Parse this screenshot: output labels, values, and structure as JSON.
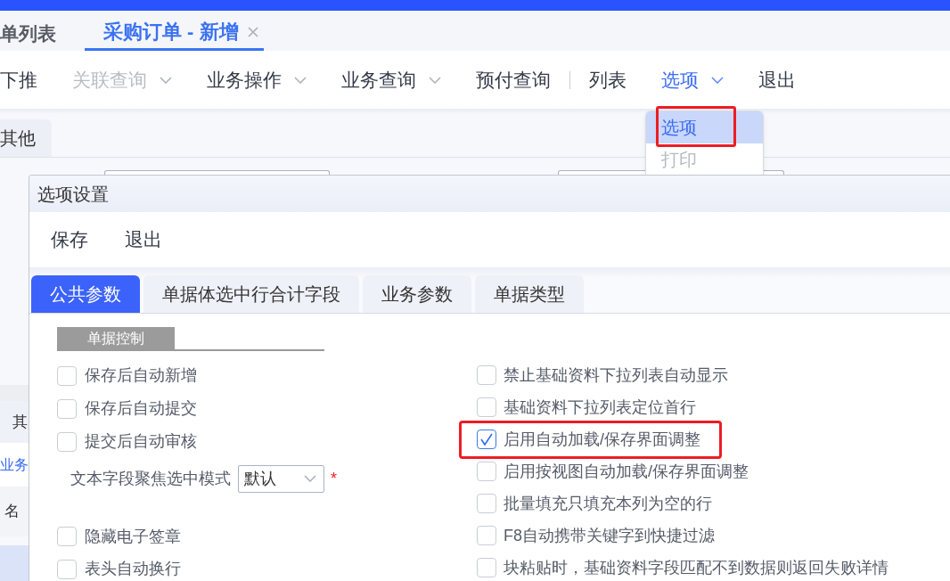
{
  "page_tabs": [
    {
      "label": "单列表",
      "selected": false,
      "closable": false
    },
    {
      "label": "采购订单 - 新增",
      "selected": true,
      "closable": true
    }
  ],
  "toolbar": [
    {
      "kind": "button",
      "label": "下推",
      "disabled": false,
      "dropdown": false,
      "selected": false
    },
    {
      "kind": "button",
      "label": "关联查询",
      "disabled": true,
      "dropdown": true,
      "selected": false
    },
    {
      "kind": "button",
      "label": "业务操作",
      "disabled": false,
      "dropdown": true,
      "selected": false
    },
    {
      "kind": "button",
      "label": "业务查询",
      "disabled": false,
      "dropdown": true,
      "selected": false
    },
    {
      "kind": "button",
      "label": "预付查询",
      "disabled": false,
      "dropdown": false,
      "selected": false
    },
    {
      "kind": "separator"
    },
    {
      "kind": "button",
      "label": "列表",
      "disabled": false,
      "dropdown": false,
      "selected": false
    },
    {
      "kind": "button",
      "label": "选项",
      "disabled": false,
      "dropdown": true,
      "selected": true
    },
    {
      "kind": "button",
      "label": "退出",
      "disabled": false,
      "dropdown": false,
      "selected": false
    }
  ],
  "toolbar_menu": {
    "items": [
      {
        "label": "选项",
        "selected": true,
        "disabled": false,
        "highlighted": true
      },
      {
        "label": "打印",
        "selected": false,
        "disabled": true,
        "highlighted": false
      }
    ]
  },
  "background_form": {
    "tabs": [
      {
        "label": "其他",
        "selected": true
      }
    ],
    "rows": [
      {
        "kind": "label",
        "text": "其"
      },
      {
        "kind": "link",
        "text": "业务"
      },
      {
        "kind": "label",
        "text": "名"
      }
    ]
  },
  "dialog": {
    "title": "选项设置",
    "toolbar": [
      "保存",
      "退出"
    ],
    "tabs": [
      {
        "label": "公共参数",
        "selected": true
      },
      {
        "label": "单据体选中行合计字段",
        "selected": false
      },
      {
        "label": "业务参数",
        "selected": false
      },
      {
        "label": "单据类型",
        "selected": false
      }
    ],
    "section_title": "单据控制",
    "left_options": [
      {
        "kind": "checkbox",
        "label": "保存后自动新增",
        "checked": false
      },
      {
        "kind": "checkbox",
        "label": "保存后自动提交",
        "checked": false
      },
      {
        "kind": "checkbox",
        "label": "提交后自动审核",
        "checked": false
      },
      {
        "kind": "select",
        "label": "文本字段聚焦选中模式",
        "value": "默认",
        "required_mark": "*"
      },
      {
        "kind": "checkbox",
        "label": "隐藏电子签章",
        "checked": false
      },
      {
        "kind": "checkbox",
        "label": "表头自动换行",
        "checked": false
      }
    ],
    "right_options": [
      {
        "label": "禁止基础资料下拉列表自动显示",
        "checked": false,
        "highlighted": false
      },
      {
        "label": "基础资料下拉列表定位首行",
        "checked": false,
        "highlighted": false
      },
      {
        "label": "启用自动加载/保存界面调整",
        "checked": true,
        "highlighted": true
      },
      {
        "label": "启用按视图自动加载/保存界面调整",
        "checked": false,
        "highlighted": false
      },
      {
        "label": "批量填充只填充本列为空的行",
        "checked": false,
        "highlighted": false
      },
      {
        "label": "F8自动携带关键字到快捷过滤",
        "checked": false,
        "highlighted": false
      },
      {
        "label": "块粘贴时，基础资料字段匹配不到数据则返回失败详情",
        "checked": false,
        "highlighted": false
      }
    ]
  }
}
